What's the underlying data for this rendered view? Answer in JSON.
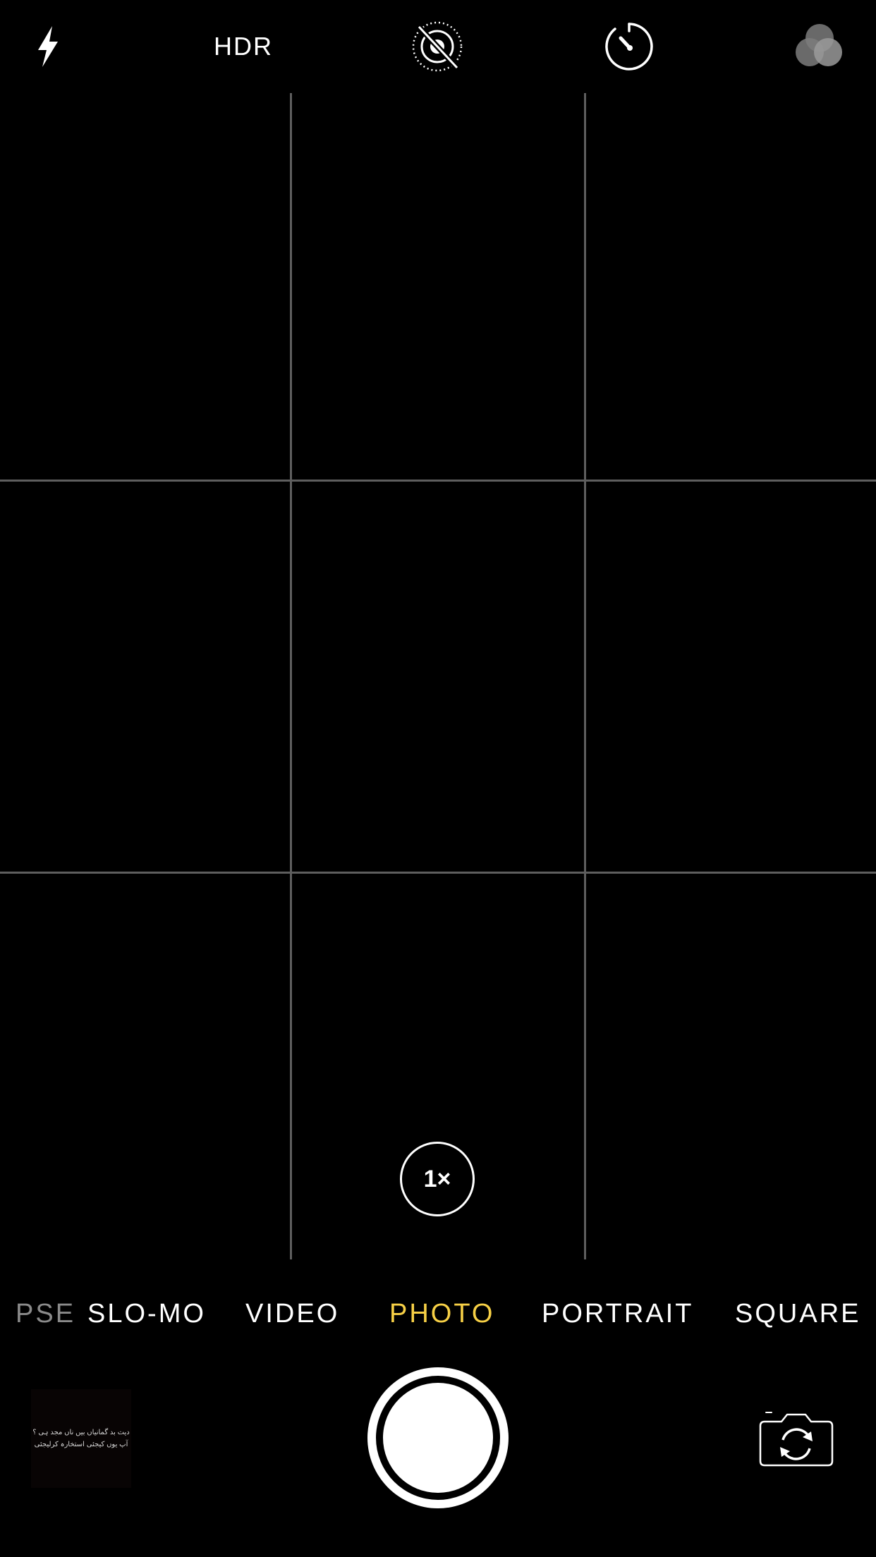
{
  "top_bar": {
    "flash_icon": "flash-bolt-icon",
    "hdr_label": "HDR",
    "live_photo_icon": "live-photo-off-icon",
    "timer_icon": "timer-icon",
    "filters_icon": "filters-icon"
  },
  "viewfinder": {
    "zoom_label": "1×"
  },
  "modes": {
    "items": [
      "PSE",
      "SLO-MO",
      "VIDEO",
      "PHOTO",
      "PORTRAIT",
      "SQUARE"
    ],
    "active": "PHOTO"
  },
  "bottom": {
    "thumbnail_lines": [
      "دیت بد گمانیاں بیں ناں مجد ہی ؟",
      "آپ یوں کیجئی استخارہ کرلیجئی"
    ],
    "shutter_icon": "shutter-button",
    "flip_icon": "flip-camera-icon"
  },
  "colors": {
    "accent": "#f7d046",
    "grid": "#5e5e5e",
    "background": "#000000"
  }
}
